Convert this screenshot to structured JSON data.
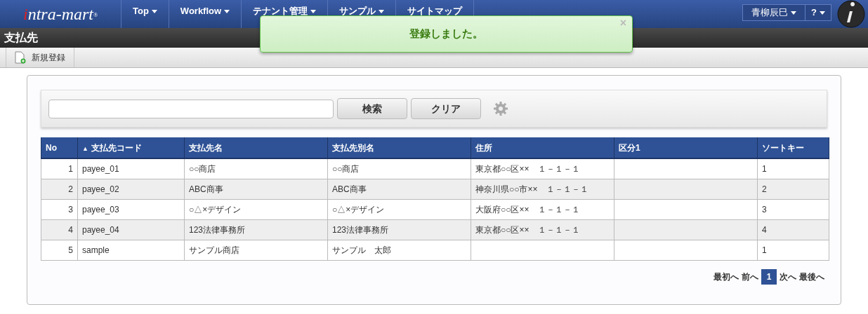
{
  "header": {
    "logo": "intra-mart",
    "logo_mark": "®",
    "menu": [
      {
        "label": "Top"
      },
      {
        "label": "Workflow"
      },
      {
        "label": "テナント管理"
      },
      {
        "label": "サンプル"
      },
      {
        "label": "サイトマップ",
        "dropdown": false
      }
    ],
    "user": "青柳辰巳",
    "help": "?"
  },
  "toast": {
    "message": "登録しました。",
    "close": "×"
  },
  "page_title": "支払先",
  "toolbar": {
    "new_button": "新規登録"
  },
  "search": {
    "search_button": "検索",
    "clear_button": "クリア"
  },
  "table": {
    "columns": [
      {
        "label": "No",
        "sorted": false
      },
      {
        "label": "支払先コード",
        "sorted": true,
        "sort_mark": "▲"
      },
      {
        "label": "支払先名",
        "sorted": false
      },
      {
        "label": "支払先別名",
        "sorted": false
      },
      {
        "label": "住所",
        "sorted": false
      },
      {
        "label": "区分1",
        "sorted": false
      },
      {
        "label": "ソートキー",
        "sorted": false
      }
    ],
    "rows": [
      [
        "1",
        "payee_01",
        "○○商店",
        "○○商店",
        "東京都○○区××　１－１－１",
        "",
        "1"
      ],
      [
        "2",
        "payee_02",
        "ABC商事",
        "ABC商事",
        "神奈川県○○市××　１－１－１",
        "",
        "2"
      ],
      [
        "3",
        "payee_03",
        "○△×デザイン",
        "○△×デザイン",
        "大阪府○○区××　１－１－１",
        "",
        "3"
      ],
      [
        "4",
        "payee_04",
        "123法律事務所",
        "123法律事務所",
        "東京都○○区××　１－１－１",
        "",
        "4"
      ],
      [
        "5",
        "sample",
        "サンプル商店",
        "サンプル　太郎",
        "",
        "",
        "1"
      ]
    ]
  },
  "pager": [
    {
      "label": "最初へ",
      "kind": "link"
    },
    {
      "label": "前へ",
      "kind": "link"
    },
    {
      "label": "1",
      "kind": "page",
      "selected": true
    },
    {
      "label": "次へ",
      "kind": "link"
    },
    {
      "label": "最後へ",
      "kind": "link"
    }
  ]
}
